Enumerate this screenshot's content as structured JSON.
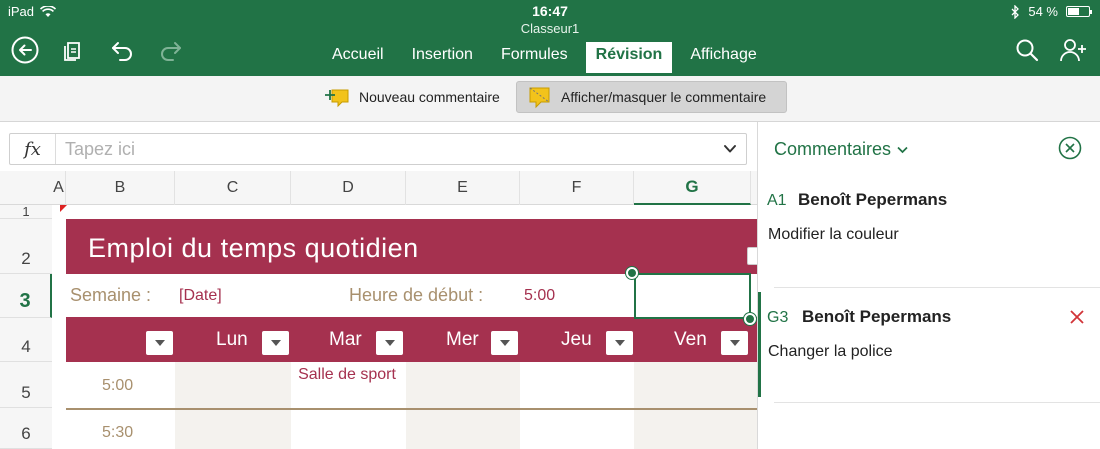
{
  "status": {
    "device": "iPad",
    "time": "16:47",
    "battery": "54 %"
  },
  "app": {
    "doc_title": "Classeur1"
  },
  "tabs": [
    {
      "label": "Accueil"
    },
    {
      "label": "Insertion"
    },
    {
      "label": "Formules"
    },
    {
      "label": "Révision",
      "active": true
    },
    {
      "label": "Affichage"
    }
  ],
  "ribbon": {
    "new_comment": "Nouveau commentaire",
    "toggle_comment": "Afficher/masquer le commentaire"
  },
  "formula_bar": {
    "fx": "fx",
    "placeholder": "Tapez ici",
    "value": ""
  },
  "columns": [
    "A",
    "B",
    "C",
    "D",
    "E",
    "F",
    "G"
  ],
  "selected_column": "G",
  "rows": [
    "1",
    "2",
    "3",
    "4",
    "5",
    "6"
  ],
  "selected_row": "3",
  "sheet": {
    "title": "Emploi du temps quotidien",
    "week_label": "Semaine :",
    "week_value": "[Date]",
    "start_label": "Heure de début :",
    "start_value": "5:00",
    "days": [
      "Lun",
      "Mar",
      "Mer",
      "Jeu",
      "Ven"
    ],
    "times": [
      "5:00",
      "5:30"
    ],
    "event": "Salle de sport"
  },
  "comments_pane": {
    "title": "Commentaires",
    "items": [
      {
        "ref": "A1",
        "author": "Benoît Pepermans",
        "text": "Modifier la couleur"
      },
      {
        "ref": "G3",
        "author": "Benoît Pepermans",
        "text": "Changer la police"
      }
    ]
  },
  "colors": {
    "excel_green": "#217346",
    "accent_red": "#a5314f",
    "tan": "#a8906e"
  }
}
